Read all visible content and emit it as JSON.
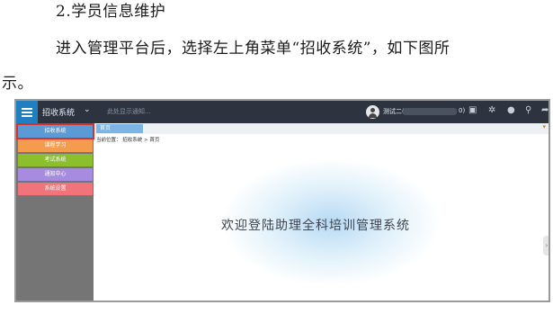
{
  "doc": {
    "heading": "2.学员信息维护",
    "para_line1": "进入管理平台后，选择左上角菜单“招收系统”，如下图所",
    "para_line2": "示。"
  },
  "app": {
    "system_title": "招收系统",
    "notice_text": "此处显示通知...",
    "user_name": "测试二(",
    "user_suffix": "0)",
    "sidebar": [
      {
        "label": "招收系统",
        "color": "#5b9bd5",
        "active": true
      },
      {
        "label": "课程学习",
        "color": "#f39c4d",
        "active": false
      },
      {
        "label": "考试系统",
        "color": "#8bbf2e",
        "active": false
      },
      {
        "label": "通知中心",
        "color": "#a68be0",
        "active": false
      },
      {
        "label": "系统设置",
        "color": "#f0747a",
        "active": false
      }
    ],
    "tab_label": "首页",
    "breadcrumb": "当前位置： 招收系统 > 首页",
    "welcome": "欢迎登陆助理全科培训管理系统"
  }
}
